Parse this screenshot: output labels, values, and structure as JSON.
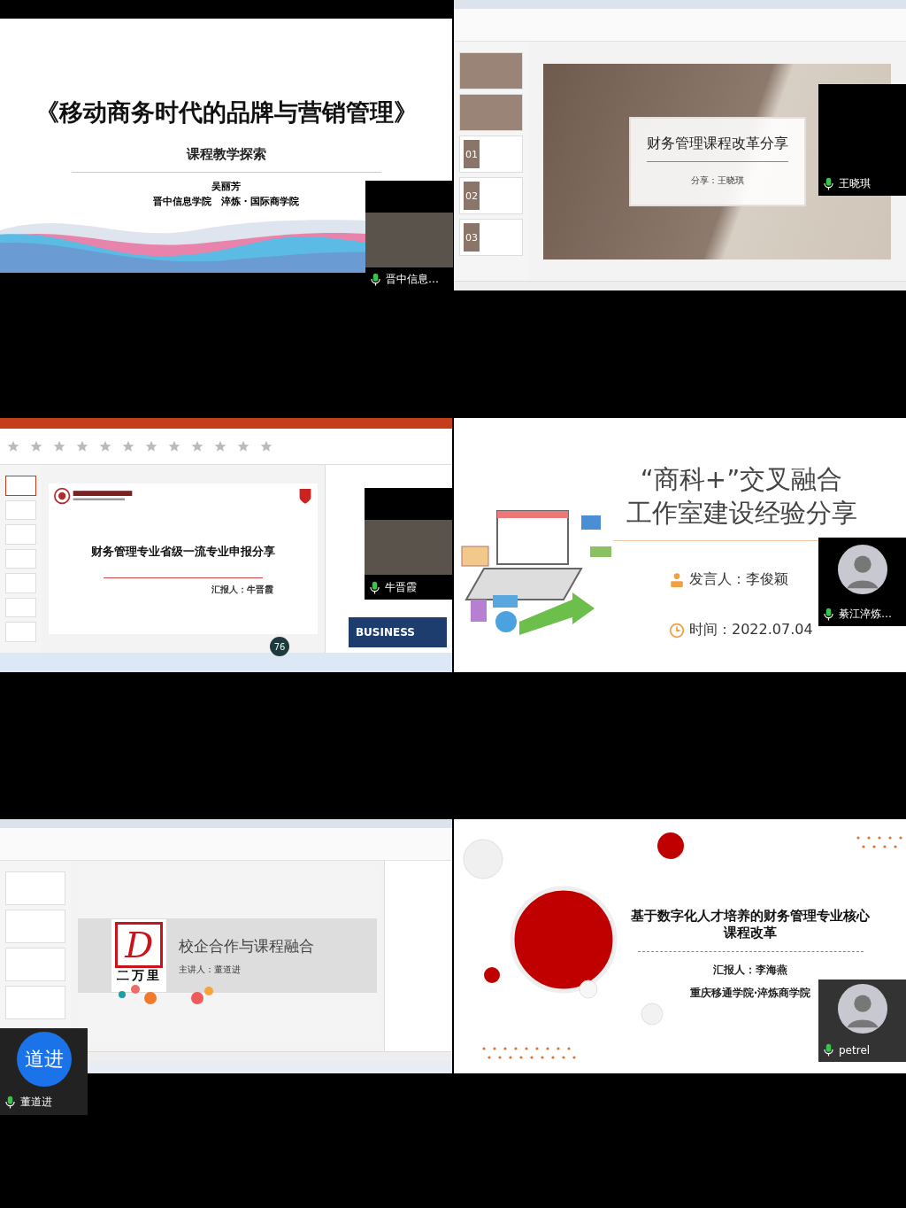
{
  "tiles": [
    {
      "kind": "waves",
      "title": "《移动商务时代的品牌与营销管理》",
      "subtitle": "课程教学探索",
      "author": "吴丽芳",
      "affiliation": "晋中信息学院　淬炼 · 国际商学院",
      "participant": {
        "name": "晋中信息…",
        "kind": "camera"
      }
    },
    {
      "kind": "wps-book",
      "title": "财务管理课程改革分享",
      "byline": "分享：王晓琪",
      "slide_numbers": [
        "01",
        "02",
        "03"
      ],
      "participant": {
        "name": "王晓琪",
        "kind": "off"
      }
    },
    {
      "kind": "ppt-college",
      "title": "财务管理专业省级一流专业申报分享",
      "reporter": "汇报人：牛晋霞",
      "banner": "BUSINESS",
      "badge": "76",
      "participant": {
        "name": "牛晋霞",
        "kind": "camera"
      }
    },
    {
      "kind": "ecommerce",
      "title_lines": [
        "“商科+”交叉融合",
        "工作室建设经验分享"
      ],
      "speaker": "发言人：李俊颖",
      "time": "时间：2022.07.04",
      "participant": {
        "name": "綦江淬炼…",
        "kind": "avatar"
      }
    },
    {
      "kind": "wps-logo",
      "title": "校企合作与课程融合",
      "presenter": "主讲人：董道进",
      "logo_letter": "D",
      "logo_text": "二万里",
      "participant": {
        "name": "董道进",
        "kind": "initials",
        "initials": "道进"
      }
    },
    {
      "kind": "red-circles",
      "title": "基于数字化人才培养的财务管理专业核心课程改革",
      "reporter": "汇报人：李海燕",
      "affiliation": "重庆移通学院·淬炼商学院",
      "participant": {
        "name": "petrel",
        "kind": "avatar"
      }
    }
  ]
}
